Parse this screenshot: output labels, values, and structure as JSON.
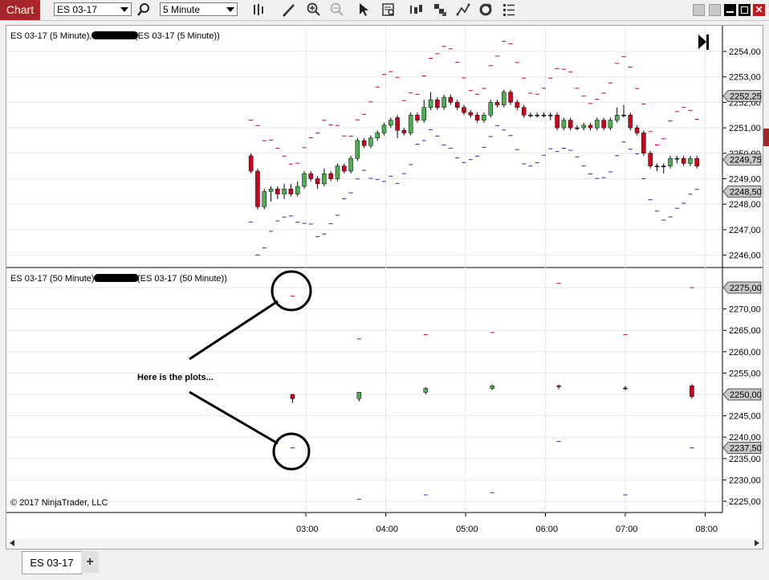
{
  "toolbar": {
    "chart_label": "Chart",
    "instrument": "ES 03-17",
    "interval": "5 Minute",
    "icons": [
      "search-icon",
      "bars-type-icon",
      "draw-pencil-icon",
      "zoom-in-icon",
      "zoom-out-icon",
      "pointer-icon",
      "data-box-icon",
      "bar-type-icon",
      "chart-style-icon",
      "drawing-tools-icon",
      "refresh-icon",
      "properties-icon"
    ]
  },
  "panel1": {
    "label_prefix": "ES 03-17 (5 Minute),",
    "label_suffix": "(ES 03-17 (5 Minute))",
    "price_ticks": [
      "2254,00",
      "2253,00",
      "2252,00",
      "2251,00",
      "2250,00",
      "2249,00",
      "2248,00",
      "2247,00",
      "2246,00"
    ],
    "markers": [
      {
        "value": "2252,25",
        "color": "#c8c8c8"
      },
      {
        "value": "2249,75",
        "color": "#c8c8c8"
      },
      {
        "value": "2248,50",
        "color": "#c8c8c8"
      }
    ]
  },
  "panel2": {
    "label_prefix": "ES 03-17 (50 Minute),",
    "label_suffix": "(ES 03-17 (50 Minute))",
    "price_ticks": [
      "2275,00",
      "2270,00",
      "2265,00",
      "2260,00",
      "2255,00",
      "2250,00",
      "2245,00",
      "2240,00",
      "2235,00",
      "2230,00",
      "2225,00"
    ],
    "markers": [
      {
        "value": "2275,00",
        "color": "#c8c8c8"
      },
      {
        "value": "2250,00",
        "color": "#c8c8c8"
      },
      {
        "value": "2237,50",
        "color": "#c8c8c8"
      }
    ],
    "annotation": "Here is the plots...",
    "copyright": "© 2017 NinjaTrader, LLC"
  },
  "time_axis": [
    "03:00",
    "04:00",
    "05:00",
    "06:00",
    "07:00",
    "08:00"
  ],
  "tabs": [
    {
      "label": "ES 03-17"
    }
  ],
  "add_tab": "+",
  "colors": {
    "up": "#4caf50",
    "down": "#d0021b",
    "upper_band": "#d0021b",
    "lower_band": "#1e2fb0",
    "toolbar_accent": "#a8262a"
  }
}
